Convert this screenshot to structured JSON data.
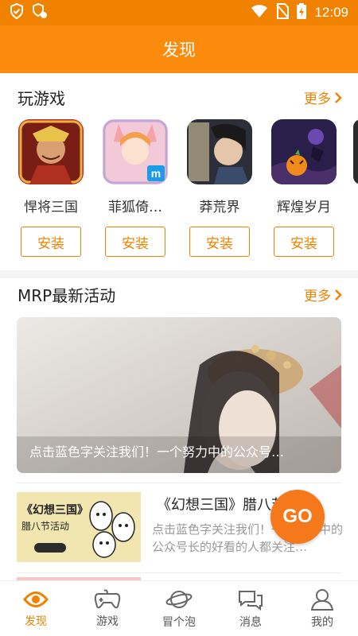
{
  "status_bar": {
    "time": "12:09",
    "icons": [
      "shield-check-icon",
      "notification-settings-icon",
      "wifi-icon",
      "no-sim-icon",
      "battery-charging-icon"
    ]
  },
  "header": {
    "title": "发现"
  },
  "play_games": {
    "heading": "玩游戏",
    "more_label": "更多",
    "games": [
      {
        "name": "悍将三国",
        "install_label": "安装"
      },
      {
        "name": "菲狐倚…",
        "install_label": "安装"
      },
      {
        "name": "莽荒界",
        "install_label": "安装"
      },
      {
        "name": "辉煌岁月",
        "install_label": "安装"
      }
    ]
  },
  "activities": {
    "heading": "MRP最新活动",
    "more_label": "更多",
    "banner_caption": "点击蓝色字关注我们！一个努力中的公众号…",
    "news": {
      "thumb_title": "《幻想三国》",
      "thumb_subtitle": "腊八节活动",
      "headline": "《幻想三国》腊八节活动",
      "summary": "点击蓝色字关注我们！一个努力中的公众号长的好看的人都关注…"
    }
  },
  "go_button": {
    "label": "GO"
  },
  "tabbar": [
    {
      "label": "发现",
      "icon": "eye-icon",
      "active": true
    },
    {
      "label": "游戏",
      "icon": "gamepad-icon",
      "active": false
    },
    {
      "label": "冒个泡",
      "icon": "planet-icon",
      "active": false
    },
    {
      "label": "消息",
      "icon": "chat-bubbles-icon",
      "active": false
    },
    {
      "label": "我的",
      "icon": "person-icon",
      "active": false
    }
  ],
  "colors": {
    "accent": "#f08200",
    "header": "#fb8b0c",
    "go_button": "#f5781b"
  }
}
